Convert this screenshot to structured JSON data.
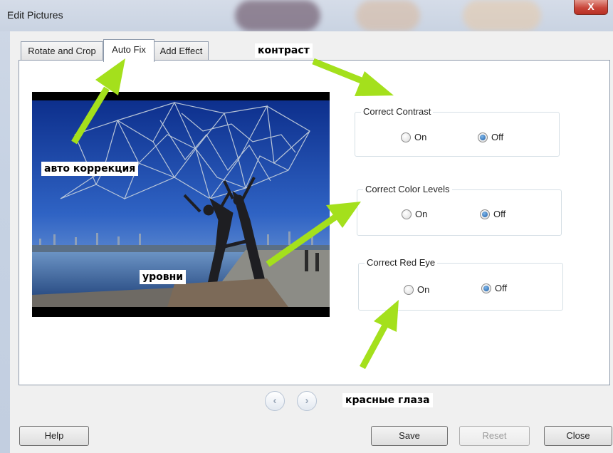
{
  "window": {
    "title": "Edit Pictures",
    "close_glyph": "X"
  },
  "tabs": [
    {
      "label": "Rotate and Crop",
      "active": false
    },
    {
      "label": "Auto Fix",
      "active": true
    },
    {
      "label": "Add Effect",
      "active": false
    }
  ],
  "groups": {
    "contrast": {
      "title": "Correct Contrast",
      "on_label": "On",
      "off_label": "Off",
      "selected": "Off"
    },
    "color_levels": {
      "title": "Correct Color Levels",
      "on_label": "On",
      "off_label": "Off",
      "selected": "Off"
    },
    "red_eye": {
      "title": "Correct Red Eye",
      "on_label": "On",
      "off_label": "Off",
      "selected": "Off"
    }
  },
  "nav": {
    "prev_icon": "chevron-left-icon",
    "next_icon": "chevron-right-icon",
    "prev_glyph": "‹",
    "next_glyph": "›"
  },
  "buttons": {
    "help": "Help",
    "save": "Save",
    "reset": "Reset",
    "close": "Close"
  },
  "annotations": {
    "contrast": "контраст",
    "auto_correction": "авто коррекция",
    "levels": "уровни",
    "red_eyes": "красные глаза"
  },
  "colors": {
    "arrow": "#a4e01c",
    "radio_selected": "#1d5ea8",
    "close_button": "#c9463a"
  }
}
